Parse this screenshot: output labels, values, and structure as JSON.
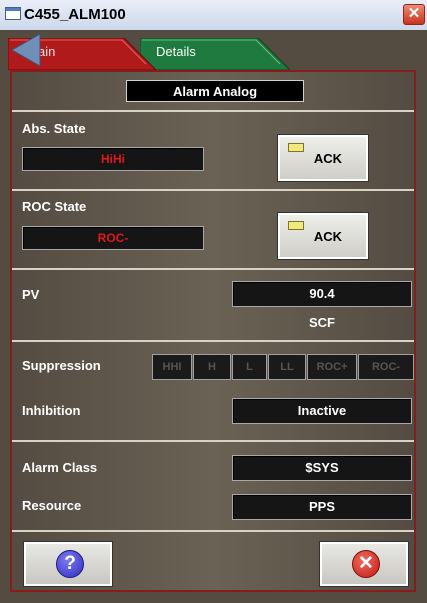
{
  "window": {
    "title": "C455_ALM100",
    "close_glyph": "✕"
  },
  "tabs": [
    {
      "label": "Main",
      "visible_label": "ain",
      "active": true,
      "color": "#b01a1a"
    },
    {
      "label": "Details",
      "visible_label": "Details",
      "active": false,
      "color": "#1e7a3e"
    }
  ],
  "section_title": "Alarm Analog",
  "abs_state": {
    "label": "Abs. State",
    "value": "HiHi",
    "value_color": "#e01818",
    "ack_label": "ACK"
  },
  "roc_state": {
    "label": "ROC State",
    "value": "ROC-",
    "value_color": "#e01818",
    "ack_label": "ACK"
  },
  "pv": {
    "label": "PV",
    "value": "90.4",
    "unit": "SCF"
  },
  "suppression": {
    "label": "Suppression",
    "items": [
      "HHI",
      "H",
      "L",
      "LL",
      "ROC+",
      "ROC-"
    ]
  },
  "inhibition": {
    "label": "Inhibition",
    "value": "Inactive"
  },
  "alarm_class": {
    "label": "Alarm Class",
    "value": "$SYS"
  },
  "resource": {
    "label": "Resource",
    "value": "PPS"
  },
  "buttons": {
    "help_glyph": "?",
    "cancel_glyph": "✕"
  },
  "icons": {
    "window": "window-icon",
    "back": "back-arrow-icon",
    "help": "help-icon",
    "cancel": "cancel-icon"
  }
}
